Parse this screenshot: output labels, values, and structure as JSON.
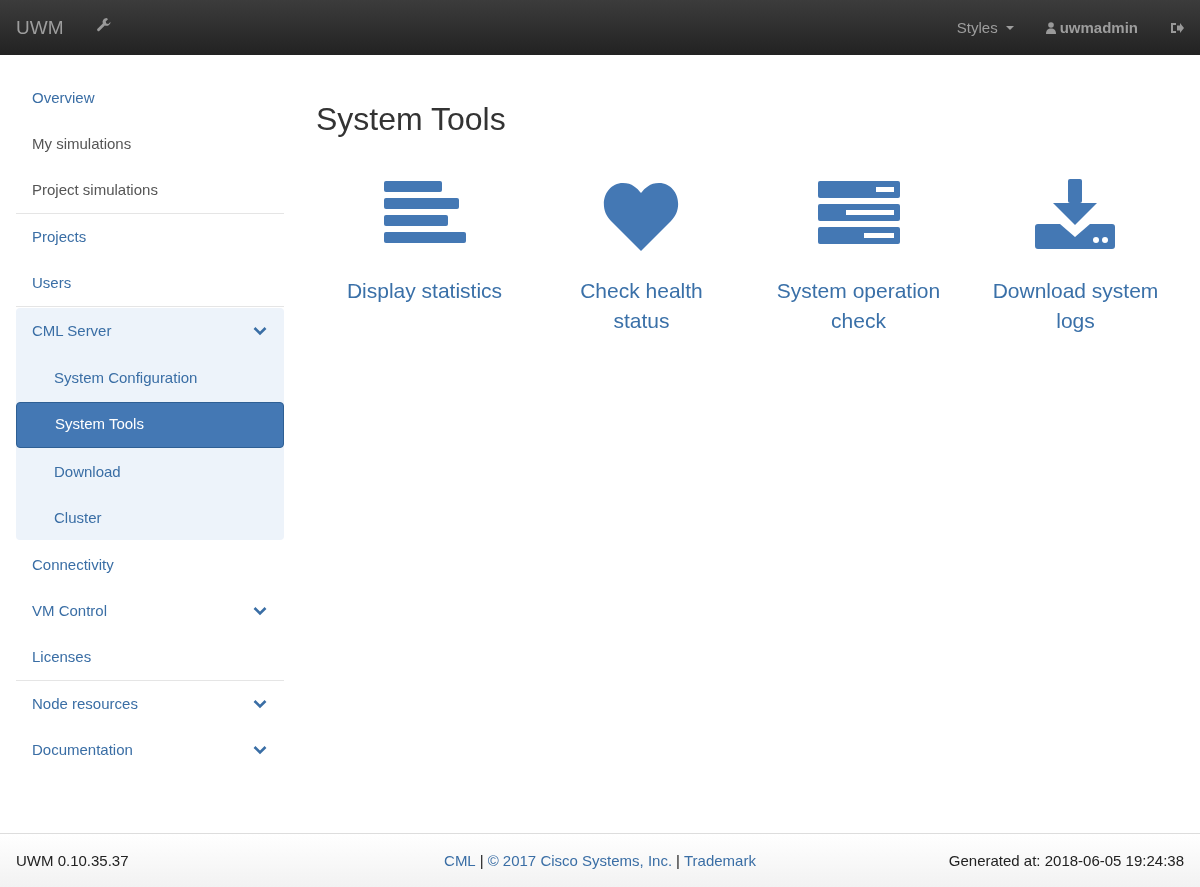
{
  "navbar": {
    "brand": "UWM",
    "styles_menu": "Styles",
    "user": "uwmadmin"
  },
  "sidebar": {
    "sections": [
      {
        "items": [
          {
            "label": "Overview",
            "muted": false,
            "selected": false
          },
          {
            "label": "My simulations",
            "muted": true,
            "selected": false
          },
          {
            "label": "Project simulations",
            "muted": true,
            "selected": false
          }
        ]
      },
      {
        "items": [
          {
            "label": "Projects",
            "muted": false,
            "selected": false
          },
          {
            "label": "Users",
            "muted": false,
            "selected": false
          }
        ]
      },
      {
        "items": [
          {
            "label": "CML Server",
            "muted": false,
            "selected": false,
            "expanded": true,
            "children": [
              {
                "label": "System Configuration",
                "selected": false
              },
              {
                "label": "System Tools",
                "selected": true
              },
              {
                "label": "Download",
                "selected": false
              },
              {
                "label": "Cluster",
                "selected": false
              }
            ]
          },
          {
            "label": "Connectivity",
            "muted": false,
            "selected": false
          },
          {
            "label": "VM Control",
            "muted": false,
            "selected": false,
            "expanded": false
          },
          {
            "label": "Licenses",
            "muted": false,
            "selected": false
          }
        ]
      },
      {
        "items": [
          {
            "label": "Node resources",
            "muted": false,
            "selected": false,
            "expanded": false
          },
          {
            "label": "Documentation",
            "muted": false,
            "selected": false,
            "expanded": false
          }
        ]
      }
    ]
  },
  "page_title": "System Tools",
  "tools": [
    {
      "kind": "statistics",
      "label": "Display statistics"
    },
    {
      "kind": "health",
      "label": "Check health status"
    },
    {
      "kind": "operation",
      "label": "System operation check"
    },
    {
      "kind": "logs",
      "label": "Download system logs"
    }
  ],
  "footer": {
    "version": "UWM 0.10.35.37",
    "links": [
      {
        "kind": "link",
        "text": "CML"
      },
      {
        "kind": "sep",
        "text": "|"
      },
      {
        "kind": "link",
        "text": "© 2017 Cisco Systems, Inc."
      },
      {
        "kind": "sep",
        "text": "|"
      },
      {
        "kind": "link",
        "text": "Trademark"
      }
    ],
    "generated": "Generated at: 2018-06-05 19:24:38"
  }
}
